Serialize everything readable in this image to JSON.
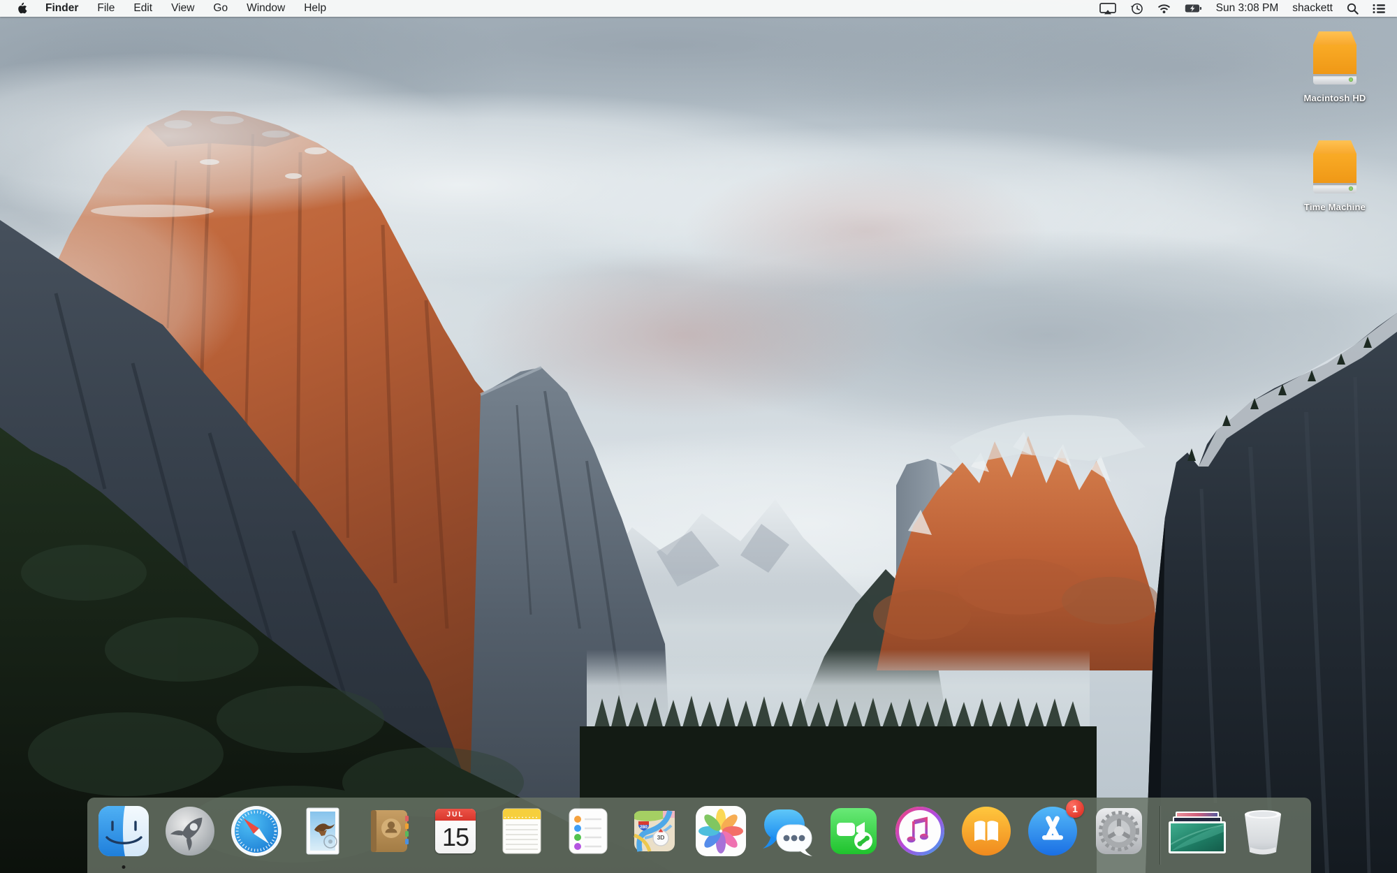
{
  "menu_bar": {
    "app_name": "Finder",
    "menus": [
      "File",
      "Edit",
      "View",
      "Go",
      "Window",
      "Help"
    ],
    "status": {
      "clock": "Sun 3:08 PM",
      "user": "shackett",
      "icons": [
        "airplay-display",
        "time-machine",
        "wifi",
        "battery-charging",
        "spotlight-search",
        "notification-center"
      ]
    }
  },
  "desktop": {
    "volumes": [
      {
        "label": "Macintosh HD",
        "icon": "orange-external-drive"
      },
      {
        "label": "Time Machine",
        "icon": "orange-external-drive"
      }
    ]
  },
  "dock": {
    "items": [
      {
        "name": "finder",
        "running": true
      },
      {
        "name": "launchpad"
      },
      {
        "name": "safari"
      },
      {
        "name": "mail"
      },
      {
        "name": "contacts"
      },
      {
        "name": "calendar",
        "month": "JUL",
        "day": "15"
      },
      {
        "name": "notes"
      },
      {
        "name": "reminders"
      },
      {
        "name": "maps",
        "shield": "280",
        "view_toggle": "3D"
      },
      {
        "name": "photos"
      },
      {
        "name": "messages"
      },
      {
        "name": "facetime"
      },
      {
        "name": "itunes"
      },
      {
        "name": "ibooks"
      },
      {
        "name": "app-store",
        "badge": "1"
      },
      {
        "name": "system-preferences"
      }
    ],
    "extras": [
      {
        "name": "desktop-pictures-stack"
      },
      {
        "name": "trash",
        "state": "empty"
      }
    ]
  },
  "colors": {
    "menu_bar_background": "#f8f9f9",
    "dock_background": "#687265",
    "badge_red": "#e23a2e",
    "drive_orange": "#f6a52b",
    "label_text": "#ffffff"
  }
}
